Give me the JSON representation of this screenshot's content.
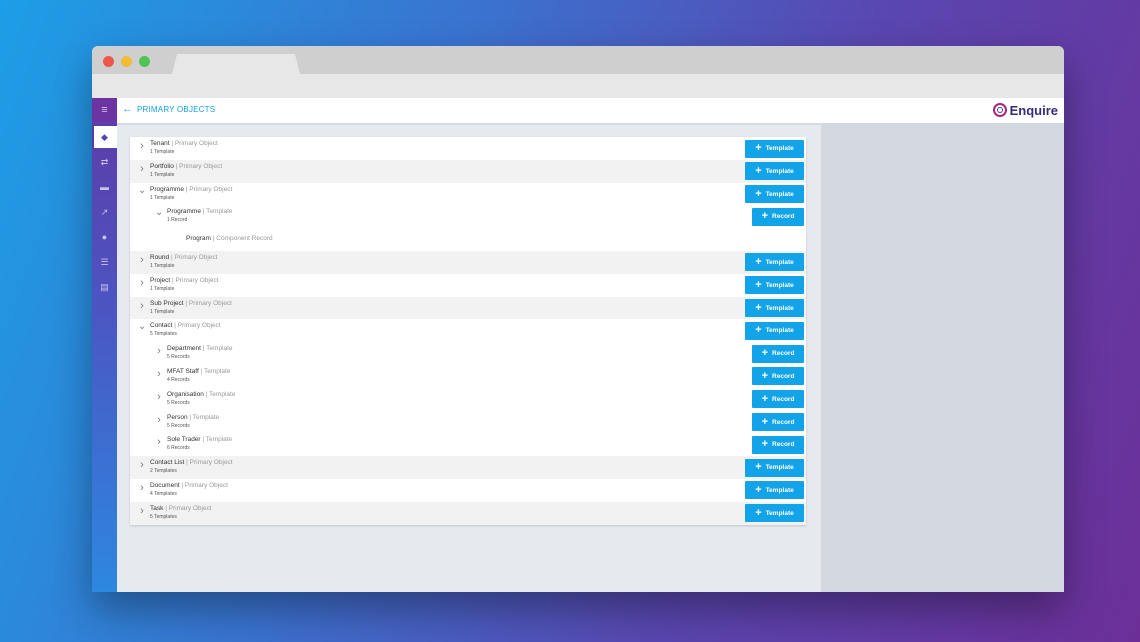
{
  "header": {
    "title": "PRIMARY OBJECTS",
    "logo_text": "Enquire"
  },
  "sidebar": {
    "items": [
      "menu-icon",
      "layers-icon",
      "routes-icon",
      "book-icon",
      "trend-icon",
      "shield-icon",
      "list-icon",
      "document-icon"
    ]
  },
  "buttons": {
    "template": "Template",
    "record": "Record"
  },
  "rows": [
    {
      "type": "object",
      "name": "Tenant",
      "kind": "| Primary Object",
      "count": "1 Template"
    },
    {
      "type": "object",
      "name": "Portfolio",
      "kind": "| Primary Object",
      "count": "1 Template"
    },
    {
      "type": "object",
      "name": "Programme",
      "kind": "| Primary Object",
      "count": "1 Template"
    },
    {
      "type": "template",
      "name": "Programme",
      "kind": "| Template",
      "count": "1 Record"
    },
    {
      "type": "component",
      "name": "Program",
      "kind": "| Component Record"
    },
    {
      "type": "object",
      "name": "Round",
      "kind": "| Primary Object",
      "count": "1 Template"
    },
    {
      "type": "object",
      "name": "Project",
      "kind": "| Primary Object",
      "count": "1 Template"
    },
    {
      "type": "object",
      "name": "Sub Project",
      "kind": "| Primary Object",
      "count": "1 Template"
    },
    {
      "type": "object",
      "name": "Contact",
      "kind": "| Primary Object",
      "count": "5 Templates"
    },
    {
      "type": "template",
      "name": "Department",
      "kind": "| Template",
      "count": "5 Records"
    },
    {
      "type": "template",
      "name": "MFAT Staff",
      "kind": "| Template",
      "count": "4 Records"
    },
    {
      "type": "template",
      "name": "Organisation",
      "kind": "| Template",
      "count": "5 Records"
    },
    {
      "type": "template",
      "name": "Person",
      "kind": "| Template",
      "count": "5 Records"
    },
    {
      "type": "template",
      "name": "Sole Trader",
      "kind": "| Template",
      "count": "6 Records"
    },
    {
      "type": "object",
      "name": "Contact List",
      "kind": "| Primary Object",
      "count": "2 Templates"
    },
    {
      "type": "object",
      "name": "Document",
      "kind": "| Primary Object",
      "count": "4 Templates"
    },
    {
      "type": "object",
      "name": "Task",
      "kind": "| Primary Object",
      "count": "5 Templates"
    }
  ]
}
